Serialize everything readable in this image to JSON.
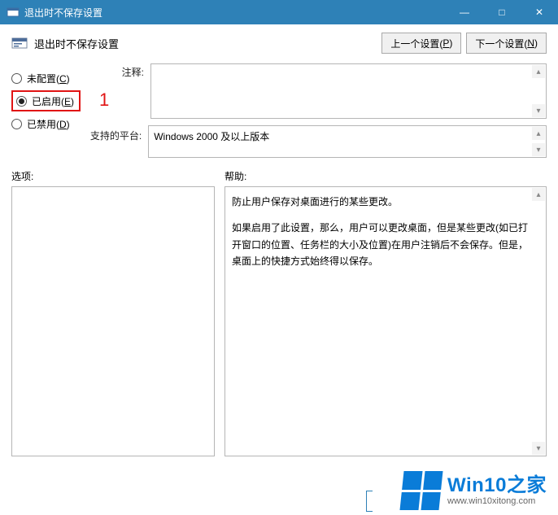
{
  "window": {
    "title": "退出时不保存设置",
    "min": "—",
    "max": "□",
    "close": "✕"
  },
  "header": {
    "heading": "退出时不保存设置",
    "prev_btn_prefix": "上一个设置(",
    "prev_btn_key": "P",
    "prev_btn_suffix": ")",
    "next_btn_prefix": "下一个设置(",
    "next_btn_key": "N",
    "next_btn_suffix": ")"
  },
  "radios": {
    "not_configured_prefix": "未配置(",
    "not_configured_key": "C",
    "not_configured_suffix": ")",
    "enabled_prefix": "已启用(",
    "enabled_key": "E",
    "enabled_suffix": ")",
    "disabled_prefix": "已禁用(",
    "disabled_key": "D",
    "disabled_suffix": ")"
  },
  "annotation": {
    "marker": "1"
  },
  "labels": {
    "comment": "注释:",
    "supported_platform": "支持的平台:",
    "options": "选项:",
    "help": "帮助:"
  },
  "values": {
    "comment_text": "",
    "supported_platform": "Windows 2000 及以上版本",
    "options_text": ""
  },
  "help": {
    "p1": "防止用户保存对桌面进行的某些更改。",
    "p2": "如果启用了此设置，那么，用户可以更改桌面，但是某些更改(如已打开窗口的位置、任务栏的大小及位置)在用户注销后不会保存。但是，桌面上的快捷方式始终得以保存。"
  },
  "watermark": {
    "brand_en": "Win10",
    "brand_zh": "之家",
    "url": "www.win10xitong.com"
  }
}
